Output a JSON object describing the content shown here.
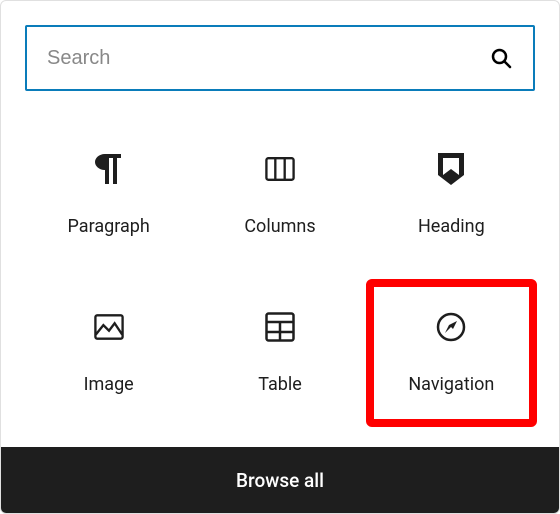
{
  "search": {
    "placeholder": "Search"
  },
  "blocks": [
    {
      "label": "Paragraph"
    },
    {
      "label": "Columns"
    },
    {
      "label": "Heading"
    },
    {
      "label": "Image"
    },
    {
      "label": "Table"
    },
    {
      "label": "Navigation"
    }
  ],
  "footer": {
    "browse_all": "Browse all"
  }
}
